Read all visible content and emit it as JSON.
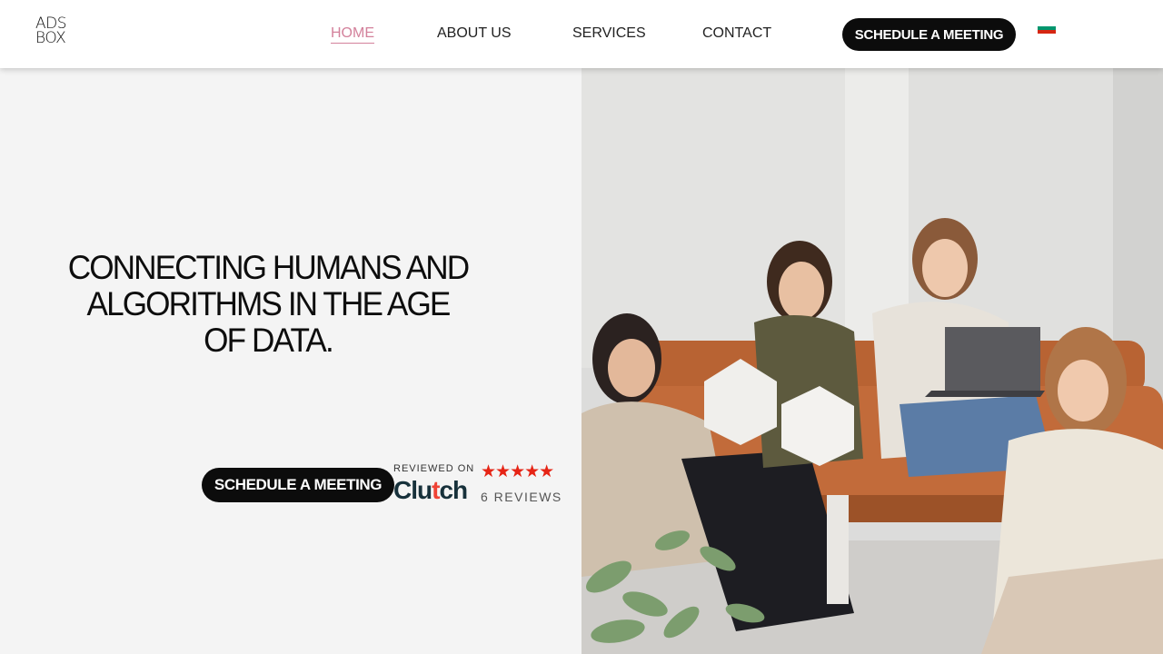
{
  "logo": {
    "line1": "ADS",
    "line2": "BOX"
  },
  "nav": {
    "items": [
      {
        "label": "HOME",
        "active": true
      },
      {
        "label": "ABOUT US",
        "active": false
      },
      {
        "label": "SERVICES",
        "active": false
      },
      {
        "label": "CONTACT",
        "active": false
      }
    ],
    "cta_label": "SCHEDULE A MEETING",
    "language_flag": "bulgarian-flag-icon"
  },
  "hero": {
    "headline": "CONNECTING HUMANS AND ALGORITHMS IN THE AGE OF DATA.",
    "cta_label": "SCHEDULE A MEETING",
    "clutch": {
      "reviewed_on": "REVIEWED ON",
      "brand": "Clutch",
      "rating_stars": 5,
      "reviews": "6 REVIEWS"
    }
  },
  "colors": {
    "accent_pink": "#d3819b",
    "button_black": "#0c0c0c",
    "star_red": "#e62415",
    "background": "#f4f4f4"
  }
}
